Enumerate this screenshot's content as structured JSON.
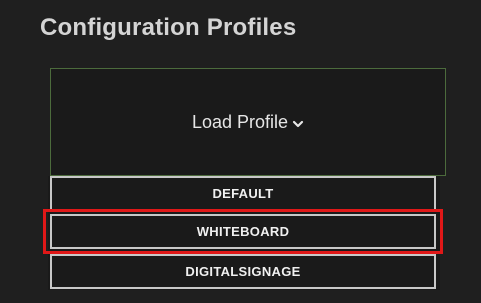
{
  "panel": {
    "title": "Configuration Profiles"
  },
  "load_profile": {
    "label": "Load Profile",
    "icon": "chevron-down-icon",
    "border_color": "#4c6b3c"
  },
  "dropdown": {
    "items": [
      {
        "label": "DEFAULT"
      },
      {
        "label": "WHITEBOARD"
      },
      {
        "label": "DIGITALSIGNAGE"
      }
    ],
    "highlighted_item": "WHITEBOARD",
    "highlight_color": "#e01818"
  }
}
